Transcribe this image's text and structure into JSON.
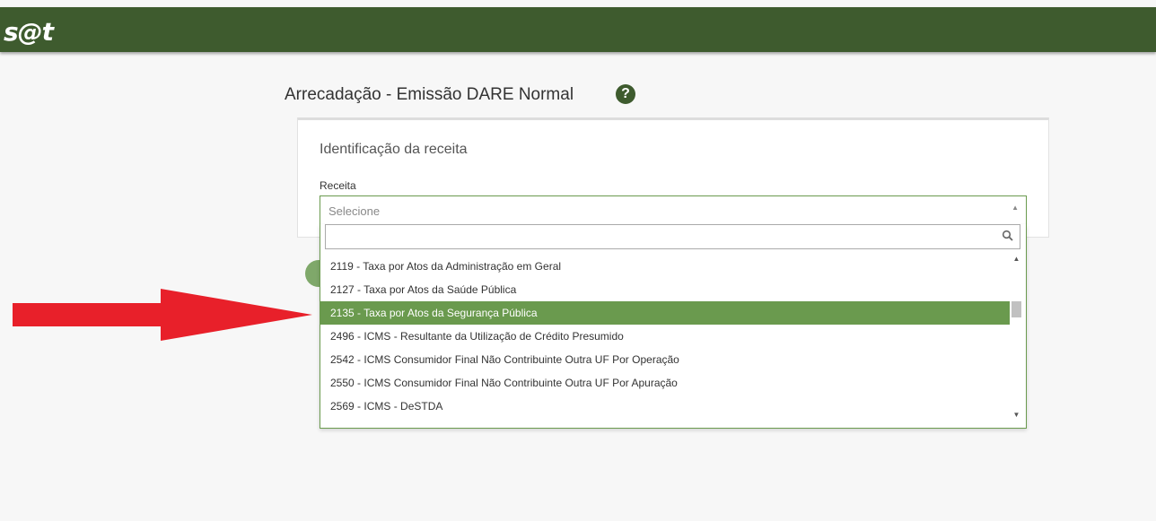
{
  "header": {
    "logo_text": "s@t",
    "bar_color": "#3e5b2e"
  },
  "page": {
    "title": "Arrecadação - Emissão DARE Normal",
    "help_icon": "question-circle-icon"
  },
  "card": {
    "title": "Identificação da receita",
    "receita_label": "Receita",
    "select_placeholder": "Selecione"
  },
  "dropdown": {
    "search_value": "",
    "options": [
      "2119 - Taxa por Atos da Administração em Geral",
      "2127 - Taxa por Atos da Saúde Pública",
      "2135 - Taxa por Atos da Segurança Pública",
      "2496 - ICMS - Resultante da Utilização de Crédito Presumido",
      "2542 - ICMS Consumidor Final Não Contribuinte Outra UF Por Operação",
      "2550 - ICMS Consumidor Final Não Contribuinte Outra UF Por Apuração",
      "2569 - ICMS - DeSTDA"
    ],
    "highlighted_index": 2,
    "highlight_color": "#6a9a4e"
  },
  "annotation": {
    "arrow_color": "#e8202a",
    "arrow_icon": "red-arrow-right"
  }
}
